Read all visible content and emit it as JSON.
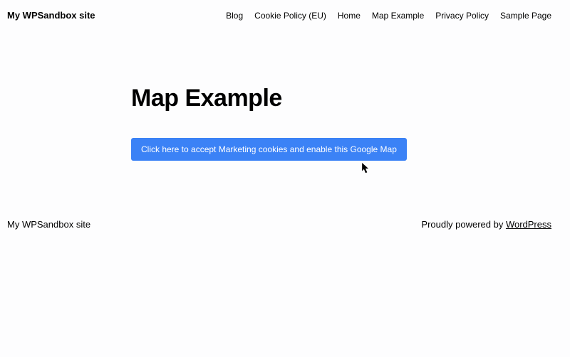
{
  "header": {
    "site_title": "My WPSandbox site",
    "nav": [
      "Blog",
      "Cookie Policy (EU)",
      "Home",
      "Map Example",
      "Privacy Policy",
      "Sample Page"
    ]
  },
  "main": {
    "page_title": "Map Example",
    "cookie_button_label": "Click here to accept Marketing cookies and enable this Google Map"
  },
  "footer": {
    "site_title": "My WPSandbox site",
    "credit_prefix": "Proudly powered by ",
    "credit_link_text": "WordPress"
  }
}
